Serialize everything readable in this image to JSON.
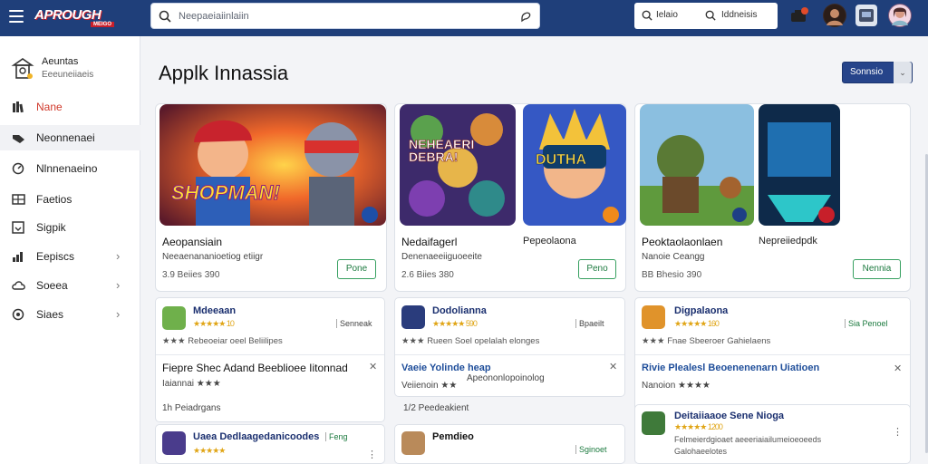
{
  "topbar": {
    "logo_text": "APROUGH",
    "logo_sub": "MEIGO",
    "search_placeholder": "Neepaeiaiinlaiin",
    "mini_a": "Ielaio",
    "mini_b": "Iddneisis"
  },
  "sidebar": {
    "brand_name": "Aeuntas",
    "brand_sub": "Eeeuneiiaeis",
    "items": [
      {
        "label": "Nane",
        "icon": "library-icon"
      },
      {
        "label": "Neonnenaei",
        "icon": "tag-icon"
      },
      {
        "label": "Nlnnenaeino",
        "icon": "gauge-icon"
      },
      {
        "label": "Faetios",
        "icon": "grid-icon"
      },
      {
        "label": "Sigpik",
        "icon": "download-icon"
      },
      {
        "label": "Eepiscs",
        "icon": "chart-icon"
      },
      {
        "label": "Soeea",
        "icon": "cloud-icon"
      },
      {
        "label": "Siaes",
        "icon": "coin-icon"
      }
    ]
  },
  "main": {
    "title": "Applk Innassia",
    "sort_label": "Sonnsio",
    "featured": [
      {
        "name": "Aeopansiain",
        "sub": "Neeaenananioetiog etiigr",
        "meta": "3.9 Beiies 390",
        "button": "Pone",
        "art": "SHOPMAN!"
      },
      {
        "name": "Nedaifagerl",
        "sub": "Denenaeeiiguoeeite",
        "meta": "2.6 Biies 380",
        "button": "Peno",
        "art": "NEHEAERI DEBRA!",
        "art2": "DUTHA",
        "side": "Pepeolaona"
      },
      {
        "name": "Peoktaolaonlaen",
        "sub": "Nanoie Ceangg",
        "meta": "BB Bhesio 390",
        "button": "Nennia",
        "side": "Nepreiiedpdk"
      }
    ],
    "list1": [
      {
        "title": "Mdeeaan",
        "stars": "★★★★★ 10",
        "sub": "★★★ Rebeoeiar oeel Beliilipes",
        "action": "Senneak"
      },
      {
        "title": "Dodolianna",
        "stars": "★★★★★ 590",
        "sub": "★★★ Rueen Soel opelalah elonges",
        "action": "Bpaeilt"
      },
      {
        "title": "Digpalaona",
        "stars": "★★★★★ 160",
        "sub": "★★★ Fnae Sbeeroer Gahielaens",
        "action": "Sia Penoel"
      }
    ],
    "promos": [
      {
        "title": "Fiepre Shec Adand Beeblioee Iitonnad",
        "sub": "Iaiannai ★★★",
        "meta": "1h  Peiadrgans"
      },
      {
        "title": "Vaeie Yolinde heap",
        "sub": "Veiienoin ★★",
        "extra": "Apeononlopoinolog",
        "meta": "1/2  Peedeakient"
      },
      {
        "title": "Rivie Plealesl Beoenenenarn Uiatioen",
        "sub": "Nanoion ★★★★"
      }
    ],
    "list2": [
      {
        "title": "Uaea Dedlaagedanicoodes",
        "tag": "Feng",
        "stars": "★★★★★"
      },
      {
        "title": "Pemdieo",
        "action": "Sginoet"
      },
      {
        "title": "Deitaiiaaoe Sene Nioga",
        "stars": "★★★★★ 1200",
        "sub": "Felmeierdgioaet aeeeriaiailumeioeoeeds",
        "sub2": "Galohaeelotes"
      }
    ]
  }
}
